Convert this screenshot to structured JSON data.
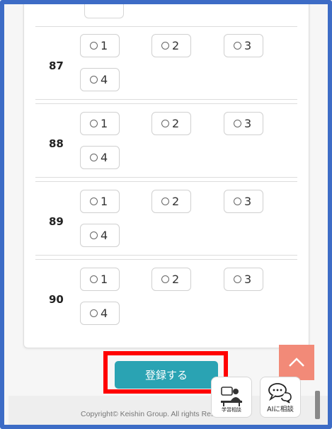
{
  "questions": [
    {
      "number": "87",
      "options": [
        "1",
        "2",
        "3",
        "4"
      ]
    },
    {
      "number": "88",
      "options": [
        "1",
        "2",
        "3",
        "4"
      ]
    },
    {
      "number": "89",
      "options": [
        "1",
        "2",
        "3",
        "4"
      ]
    },
    {
      "number": "90",
      "options": [
        "1",
        "2",
        "3",
        "4"
      ]
    }
  ],
  "register_button": {
    "label": "登録する"
  },
  "footer": {
    "copyright": "Copyright© Keishin Group. All rights Reserved."
  },
  "floating": {
    "study_consult_label": "学習相談",
    "ai_consult_label": "AIに相談"
  },
  "icons": {
    "scroll_top": "chevron-up-icon",
    "study_consult": "person-desk-icon",
    "ai_consult": "chat-bubbles-icon"
  },
  "colors": {
    "frame": "#3d6cc6",
    "primary_button": "#2aa3b3",
    "highlight": "#ff0000",
    "scroll_top": "#f28a78"
  }
}
